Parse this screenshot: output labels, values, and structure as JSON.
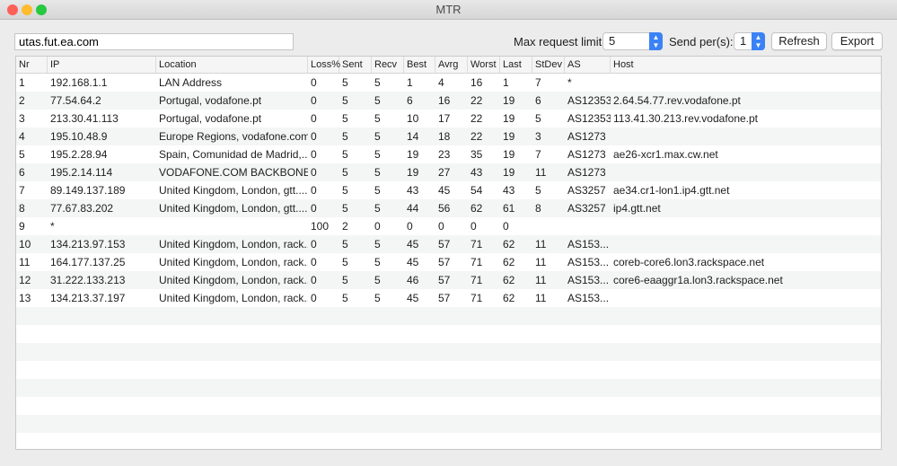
{
  "window": {
    "title": "MTR"
  },
  "colors": {
    "accent": "#3b82f6",
    "close": "#fe5f57",
    "minimize": "#febc2e",
    "zoom": "#28c840"
  },
  "toolbar": {
    "host_value": "utas.fut.ea.com",
    "max_request_label": "Max request limit:",
    "max_request_value": "5",
    "send_per_label": "Send per(s):",
    "send_per_value": "1",
    "refresh_label": "Refresh",
    "export_label": "Export"
  },
  "table": {
    "columns": [
      "Nr",
      "IP",
      "Location",
      "Loss%",
      "Sent",
      "Recv",
      "Best",
      "Avrg",
      "Worst",
      "Last",
      "StDev",
      "AS",
      "Host"
    ],
    "rows": [
      [
        "1",
        "192.168.1.1",
        "LAN Address",
        "0",
        "5",
        "5",
        "1",
        "4",
        "16",
        "1",
        "7",
        "*",
        ""
      ],
      [
        "2",
        "77.54.64.2",
        "Portugal, vodafone.pt",
        "0",
        "5",
        "5",
        "6",
        "16",
        "22",
        "19",
        "6",
        "AS12353",
        "2.64.54.77.rev.vodafone.pt"
      ],
      [
        "3",
        "213.30.41.113",
        "Portugal, vodafone.pt",
        "0",
        "5",
        "5",
        "10",
        "17",
        "22",
        "19",
        "5",
        "AS12353",
        "113.41.30.213.rev.vodafone.pt"
      ],
      [
        "4",
        "195.10.48.9",
        "Europe Regions, vodafone.com",
        "0",
        "5",
        "5",
        "14",
        "18",
        "22",
        "19",
        "3",
        "AS1273",
        ""
      ],
      [
        "5",
        "195.2.28.94",
        "Spain, Comunidad de Madrid,...",
        "0",
        "5",
        "5",
        "19",
        "23",
        "35",
        "19",
        "7",
        "AS1273",
        "ae26-xcr1.max.cw.net"
      ],
      [
        "6",
        "195.2.14.114",
        "VODAFONE.COM BACKBONE,...",
        "0",
        "5",
        "5",
        "19",
        "27",
        "43",
        "19",
        "11",
        "AS1273",
        ""
      ],
      [
        "7",
        "89.149.137.189",
        "United Kingdom, London, gtt....",
        "0",
        "5",
        "5",
        "43",
        "45",
        "54",
        "43",
        "5",
        "AS3257",
        "ae34.cr1-lon1.ip4.gtt.net"
      ],
      [
        "8",
        "77.67.83.202",
        "United Kingdom, London, gtt....",
        "0",
        "5",
        "5",
        "44",
        "56",
        "62",
        "61",
        "8",
        "AS3257",
        "ip4.gtt.net"
      ],
      [
        "9",
        "*",
        "",
        "100",
        "2",
        "0",
        "0",
        "0",
        "0",
        "0",
        "",
        "",
        ""
      ],
      [
        "10",
        "134.213.97.153",
        "United Kingdom, London, rack...",
        "0",
        "5",
        "5",
        "45",
        "57",
        "71",
        "62",
        "11",
        "AS153...",
        ""
      ],
      [
        "11",
        "164.177.137.25",
        "United Kingdom, London, rack...",
        "0",
        "5",
        "5",
        "45",
        "57",
        "71",
        "62",
        "11",
        "AS153...",
        "coreb-core6.lon3.rackspace.net"
      ],
      [
        "12",
        "31.222.133.213",
        "United Kingdom, London, rack...",
        "0",
        "5",
        "5",
        "46",
        "57",
        "71",
        "62",
        "11",
        "AS153...",
        "core6-eaaggr1a.lon3.rackspace.net"
      ],
      [
        "13",
        "134.213.37.197",
        "United Kingdom, London, rack...",
        "0",
        "5",
        "5",
        "45",
        "57",
        "71",
        "62",
        "11",
        "AS153...",
        ""
      ]
    ]
  }
}
